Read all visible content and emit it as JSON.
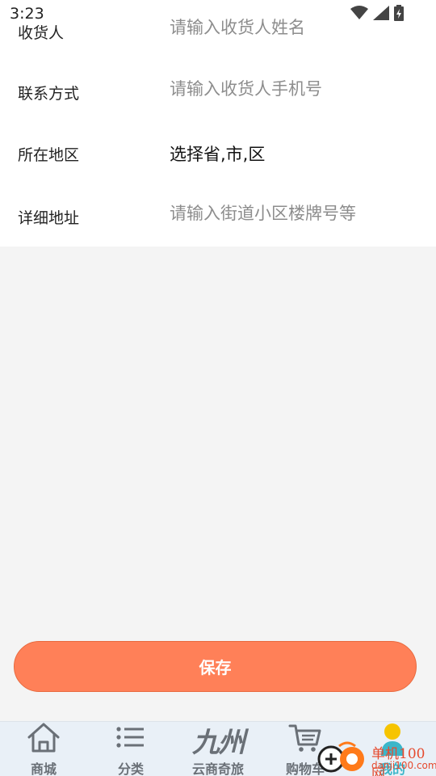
{
  "status_bar": {
    "time": "3:23"
  },
  "form": {
    "rows": [
      {
        "label": "收货人",
        "placeholder": "请输入收货人姓名"
      },
      {
        "label": "联系方式",
        "placeholder": "请输入收货人手机号"
      },
      {
        "label": "所在地区",
        "value": "选择省,市,区"
      },
      {
        "label": "详细地址",
        "placeholder": "请输入街道小区楼牌号等"
      }
    ]
  },
  "save_label": "保存",
  "tab_bar": {
    "items": [
      {
        "label": "商城",
        "icon": "home-icon"
      },
      {
        "label": "分类",
        "icon": "list-icon"
      },
      {
        "label": "云商奇旅",
        "icon": "jiuzhou-logo-icon",
        "logo_text": "九州"
      },
      {
        "label": "购物车",
        "icon": "cart-icon"
      },
      {
        "label": "我的",
        "icon": "user-icon"
      }
    ]
  },
  "watermark": {
    "text": "单机100网",
    "url": "danji100.com"
  },
  "colors": {
    "accent": "#ff8058",
    "tab_bar_bg": "#e9f0f7",
    "user_icon": "#f6c400",
    "user_icon_body": "#3bb6c9"
  }
}
